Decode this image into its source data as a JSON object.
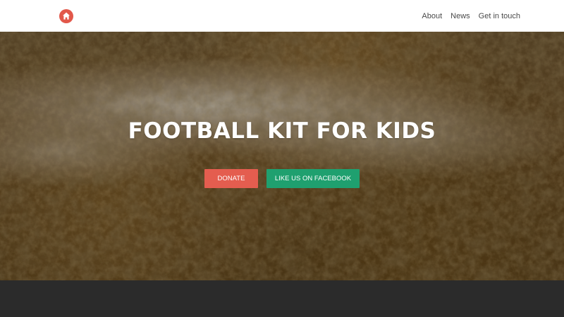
{
  "nav": {
    "logo_icon": "home-icon",
    "logo_color": "#e2584a",
    "links": [
      {
        "label": "About"
      },
      {
        "label": "News"
      },
      {
        "label": "Get in touch"
      }
    ]
  },
  "hero": {
    "title": "FOOTBALL KIT FOR KIDS",
    "donate_label": "DONATE",
    "donate_color": "#e45d4f",
    "facebook_label": "LIKE US ON FACEBOOK",
    "facebook_color": "#1fa06f"
  },
  "footer": {
    "background": "#2b2b2b"
  }
}
